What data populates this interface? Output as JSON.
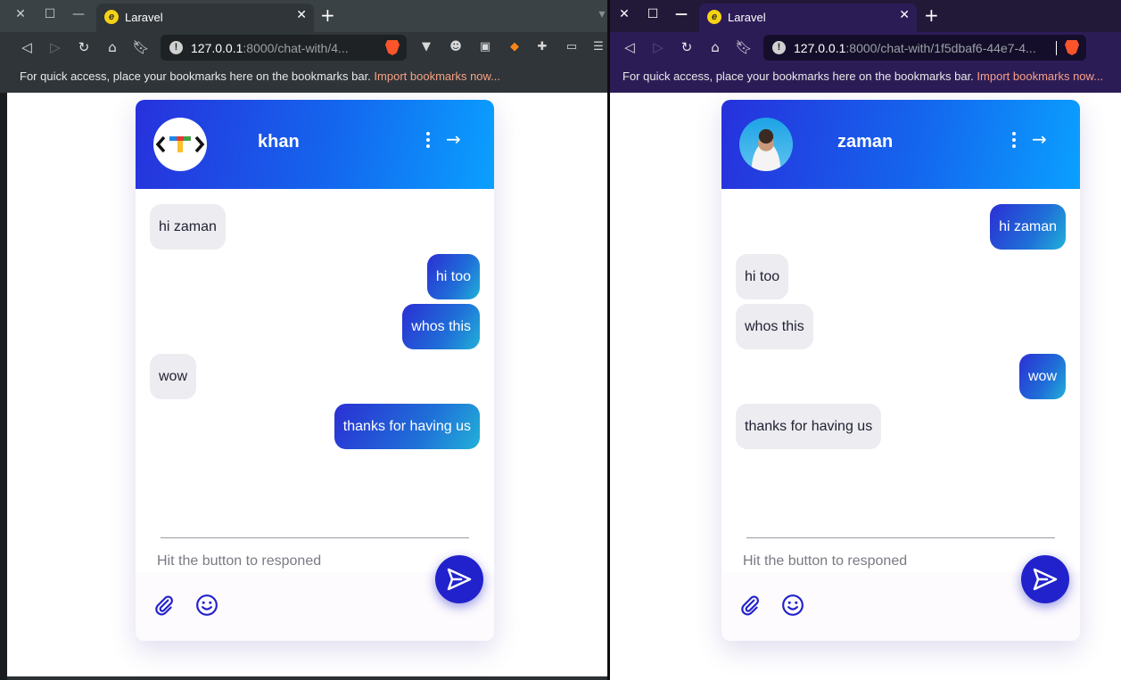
{
  "left_window": {
    "tab_title": "Laravel",
    "url_host": "127.0.0.1",
    "url_rest": ":8000/chat-with/4...",
    "bookmarks_text": "For quick access, place your bookmarks here on the bookmarks bar.",
    "bookmarks_link": "Import bookmarks now...",
    "chat": {
      "contact_name": "khan",
      "messages": [
        {
          "text": "hi zaman",
          "direction": "in"
        },
        {
          "text": "hi too",
          "direction": "out"
        },
        {
          "text": "whos this",
          "direction": "out"
        },
        {
          "text": "wow",
          "direction": "in"
        },
        {
          "text": "thanks for having us",
          "direction": "out"
        }
      ],
      "input_placeholder": "Hit the button to responed"
    }
  },
  "right_window": {
    "tab_title": "Laravel",
    "url_host": "127.0.0.1",
    "url_rest": ":8000/chat-with/1f5dbaf6-44e7-4...",
    "bookmarks_text": "For quick access, place your bookmarks here on the bookmarks bar.",
    "bookmarks_link": "Import bookmarks now...",
    "chat": {
      "contact_name": "zaman",
      "messages": [
        {
          "text": "hi zaman",
          "direction": "out"
        },
        {
          "text": "hi too",
          "direction": "in"
        },
        {
          "text": "whos this",
          "direction": "in"
        },
        {
          "text": "wow",
          "direction": "out"
        },
        {
          "text": "thanks for having us",
          "direction": "in"
        }
      ],
      "input_placeholder": "Hit the button to responed"
    }
  },
  "colors": {
    "header_gradient_start": "#2731dc",
    "header_gradient_end": "#0aa0ff",
    "outgoing_bubble": "#2b2fd4",
    "incoming_bubble": "#ececf1",
    "send_button": "#2222cc",
    "tool_icon": "#2222cc"
  }
}
